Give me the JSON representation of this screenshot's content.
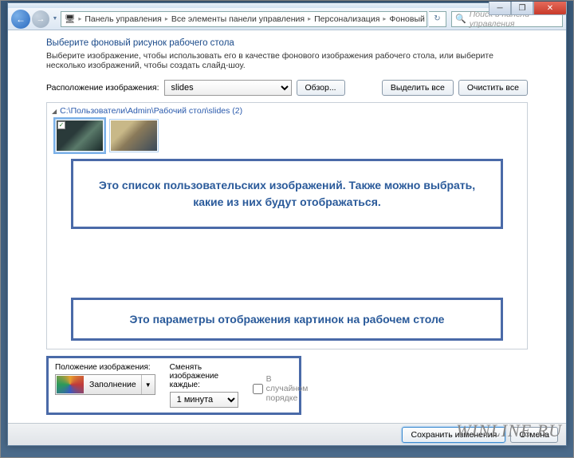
{
  "window_controls": {
    "min": "─",
    "max": "❐",
    "close": "✕"
  },
  "nav": {
    "back_glyph": "←",
    "fwd_glyph": "→",
    "drop_glyph": "▼",
    "refresh_glyph": "↻"
  },
  "breadcrumb": {
    "icon": "🖥",
    "sep": "▸",
    "items": [
      "Панель управления",
      "Все элементы панели управления",
      "Персонализация",
      "Фоновый рисунок рабочего стола"
    ]
  },
  "search": {
    "icon": "🔍",
    "placeholder": "Поиск в панели управления"
  },
  "page": {
    "title": "Выберите фоновый рисунок рабочего стола",
    "subtitle": "Выберите изображение, чтобы использовать его в качестве фонового изображения рабочего стола, или выберите несколько изображений, чтобы создать слайд-шоу."
  },
  "location": {
    "label": "Расположение изображения:",
    "value": "slides",
    "browse": "Обзор...",
    "select_all": "Выделить все",
    "clear_all": "Очистить все"
  },
  "folder": {
    "triangle": "◢",
    "path": "C:\\Пользователи\\Admin\\Рабочий стол\\slides (2)",
    "check": "✓"
  },
  "annotations": {
    "a1": "Это список пользовательских изображений. Также можно выбрать, какие из них будут отображаться.",
    "a2": "Это параметры отображения картинок на рабочем столе"
  },
  "settings": {
    "pos_label": "Положение изображения:",
    "pos_value": "Заполнение",
    "interval_label": "Сменять изображение каждые:",
    "interval_value": "1 минута",
    "shuffle": "В случайном порядке",
    "arrow": "▼"
  },
  "footer": {
    "save": "Сохранить изменения",
    "cancel": "Отмена"
  },
  "watermark": "WINLINE.RU"
}
